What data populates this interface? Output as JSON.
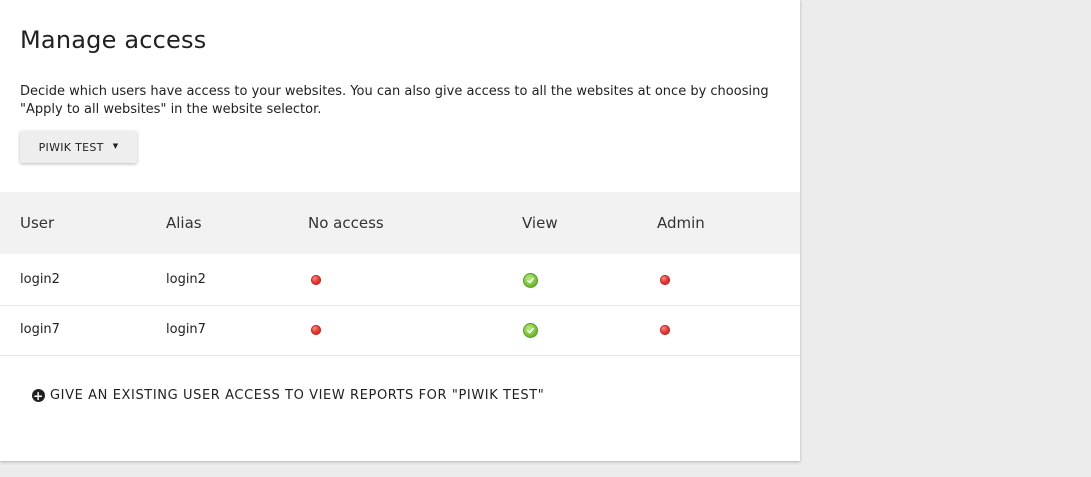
{
  "page": {
    "title": "Manage access",
    "description": "Decide which users have access to your websites. You can also give access to all the websites at once by choosing \"Apply to all websites\" in the website selector."
  },
  "site_selector": {
    "label": "PIWIK TEST",
    "caret": "▼"
  },
  "table": {
    "headers": {
      "user": "User",
      "alias": "Alias",
      "no_access": "No access",
      "view": "View",
      "admin": "Admin"
    },
    "rows": [
      {
        "user": "login2",
        "alias": "login2",
        "access": "view"
      },
      {
        "user": "login7",
        "alias": "login7",
        "access": "view"
      }
    ]
  },
  "give_access": {
    "label": "GIVE AN EXISTING USER ACCESS TO VIEW REPORTS FOR \"PIWIK TEST\"",
    "icon": "plus-circle-icon"
  },
  "colors": {
    "access_denied": "#e53935",
    "access_granted": "#7cc63a"
  }
}
